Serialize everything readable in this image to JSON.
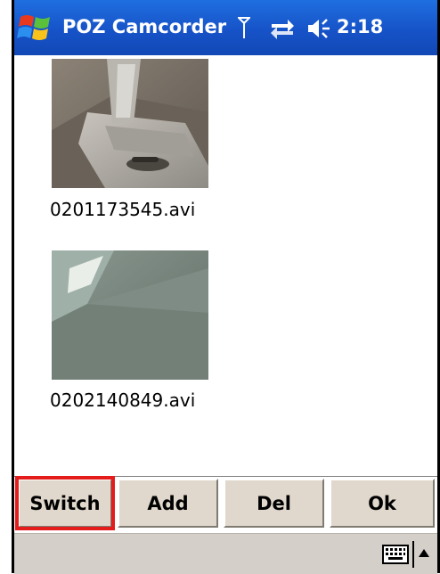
{
  "titlebar": {
    "app_title": "POZ Camcorder",
    "clock": "2:18",
    "icons": [
      "windows-start-icon",
      "signal-icon",
      "connectivity-icon",
      "volume-icon"
    ],
    "colors": {
      "background": "#1653c8",
      "text": "#ffffff"
    }
  },
  "files": [
    {
      "name": "0201173545.avi",
      "thumbnail": "camera-phone-thumbnail"
    },
    {
      "name": "0202140849.avi",
      "thumbnail": "floor-corner-thumbnail"
    }
  ],
  "buttons": {
    "switch_label": "Switch",
    "add_label": "Add",
    "del_label": "Del",
    "ok_label": "Ok",
    "highlighted": "Switch",
    "highlight_color": "#e41c1c"
  },
  "menubar": {
    "icons": [
      "keyboard-icon",
      "sip-arrow-up-icon"
    ]
  }
}
